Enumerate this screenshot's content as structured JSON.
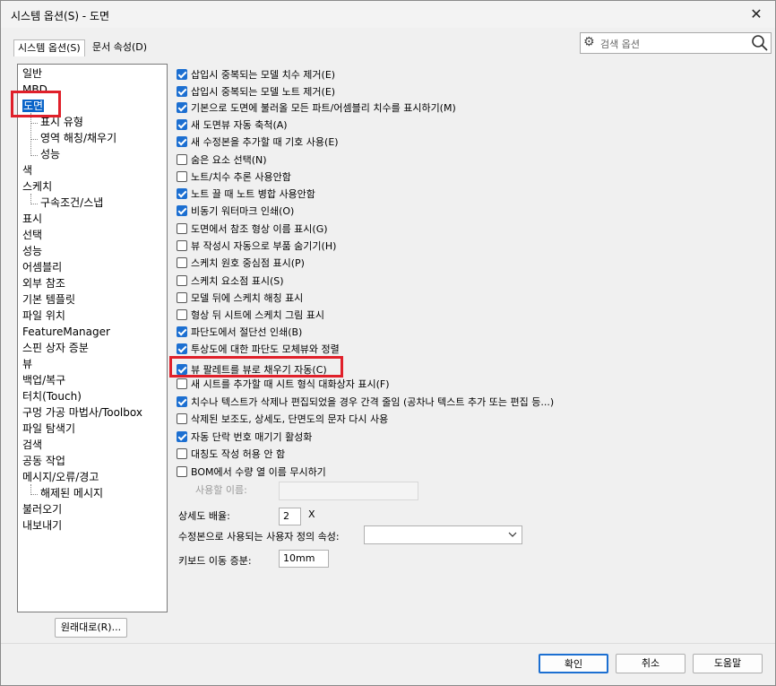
{
  "window": {
    "title": "시스템 옵션(S) - 도면",
    "close_icon": "close-icon"
  },
  "tabs": [
    {
      "label": "시스템 옵션(S)",
      "active": true
    },
    {
      "label": "문서 속성(D)",
      "active": false
    }
  ],
  "search": {
    "placeholder": "검색 옵션"
  },
  "tree": {
    "items": [
      {
        "label": "일반",
        "level": 0
      },
      {
        "label": "MBD",
        "level": 0
      },
      {
        "label": "도면",
        "level": 0,
        "selected": true
      },
      {
        "label": "표시 유형",
        "level": 1
      },
      {
        "label": "영역 해칭/채우기",
        "level": 1
      },
      {
        "label": "성능",
        "level": 1
      },
      {
        "label": "색",
        "level": 0
      },
      {
        "label": "스케치",
        "level": 0
      },
      {
        "label": "구속조건/스냅",
        "level": 1
      },
      {
        "label": "표시",
        "level": 0
      },
      {
        "label": "선택",
        "level": 0
      },
      {
        "label": "성능",
        "level": 0
      },
      {
        "label": "어셈블리",
        "level": 0
      },
      {
        "label": "외부 참조",
        "level": 0
      },
      {
        "label": "기본 템플릿",
        "level": 0
      },
      {
        "label": "파일 위치",
        "level": 0
      },
      {
        "label": "FeatureManager",
        "level": 0
      },
      {
        "label": "스핀 상자 증분",
        "level": 0
      },
      {
        "label": "뷰",
        "level": 0
      },
      {
        "label": "백업/복구",
        "level": 0
      },
      {
        "label": "터치(Touch)",
        "level": 0
      },
      {
        "label": "구멍 가공 마법사/Toolbox",
        "level": 0
      },
      {
        "label": "파일 탐색기",
        "level": 0
      },
      {
        "label": "검색",
        "level": 0
      },
      {
        "label": "공동 작업",
        "level": 0
      },
      {
        "label": "메시지/오류/경고",
        "level": 0
      },
      {
        "label": "해제된 메시지",
        "level": 1
      },
      {
        "label": "불러오기",
        "level": 0
      },
      {
        "label": "내보내기",
        "level": 0
      }
    ]
  },
  "options": [
    {
      "label": "삽입시 중복되는 모델 치수 제거(E)",
      "checked": true
    },
    {
      "label": "삽입시 중복되는 모델 노트 제거(E)",
      "checked": true
    },
    {
      "label": "기본으로 도면에 불러올 모든 파트/어셈블리 치수를 표시하기(M)",
      "checked": true
    },
    {
      "label": "새 도면뷰 자동 축척(A)",
      "checked": true
    },
    {
      "label": "새 수정본을 추가할 때 기호 사용(E)",
      "checked": true
    },
    {
      "label": "숨은 요소 선택(N)",
      "checked": false
    },
    {
      "label": "노트/치수 추론 사용안함",
      "checked": false
    },
    {
      "label": "노트 끌 때 노트 병합 사용안함",
      "checked": true
    },
    {
      "label": "비동기 워터마크 인쇄(O)",
      "checked": true
    },
    {
      "label": "도면에서 참조 형상 이름 표시(G)",
      "checked": false
    },
    {
      "label": "뷰 작성시 자동으로 부품 숨기기(H)",
      "checked": false
    },
    {
      "label": "스케치 원호 중심점 표시(P)",
      "checked": false
    },
    {
      "label": "스케치 요소점 표시(S)",
      "checked": false
    },
    {
      "label": "모델 뒤에 스케치 해칭 표시",
      "checked": false
    },
    {
      "label": "형상 뒤 시트에 스케치 그림 표시",
      "checked": false
    },
    {
      "label": "파단도에서 절단선 인쇄(B)",
      "checked": true
    },
    {
      "label": "투상도에 대한 파단도 모체뷰와 정렬",
      "checked": true
    },
    {
      "label": "뷰 팔레트를 뷰로 채우기 자동(C)",
      "checked": true
    },
    {
      "label": "새 시트를 추가할 때 시트 형식 대화상자 표시(F)",
      "checked": false
    },
    {
      "label": "치수나 텍스트가 삭제나 편집되었을 경우 간격 줄임 (공차나 텍스트 추가 또는 편집 등...)",
      "checked": true
    },
    {
      "label": "삭제된 보조도, 상세도, 단면도의 문자 다시 사용",
      "checked": false
    },
    {
      "label": "자동 단락 번호 매기기 활성화",
      "checked": true
    },
    {
      "label": "대칭도 작성 허용 안 함",
      "checked": false
    },
    {
      "label": "BOM에서 수량 열 이름 무시하기",
      "checked": false
    }
  ],
  "fields": {
    "qty_name_label": "사용할 이름:",
    "detail_scale_label": "상세도 배율:",
    "detail_scale_value": "2",
    "detail_scale_unit": "X",
    "custom_prop_label": "수정본으로 사용되는 사용자 정의 속성:",
    "custom_prop_value": "",
    "keyboard_step_label": "키보드 이동 증분:",
    "keyboard_step_value": "10mm"
  },
  "buttons": {
    "reset": "원래대로(R)...",
    "ok": "확인",
    "cancel": "취소",
    "help": "도움말"
  },
  "colors": {
    "highlight_box": "#e0202a",
    "selection": "#0a64c8",
    "checkbox": "#1c6fd1"
  }
}
